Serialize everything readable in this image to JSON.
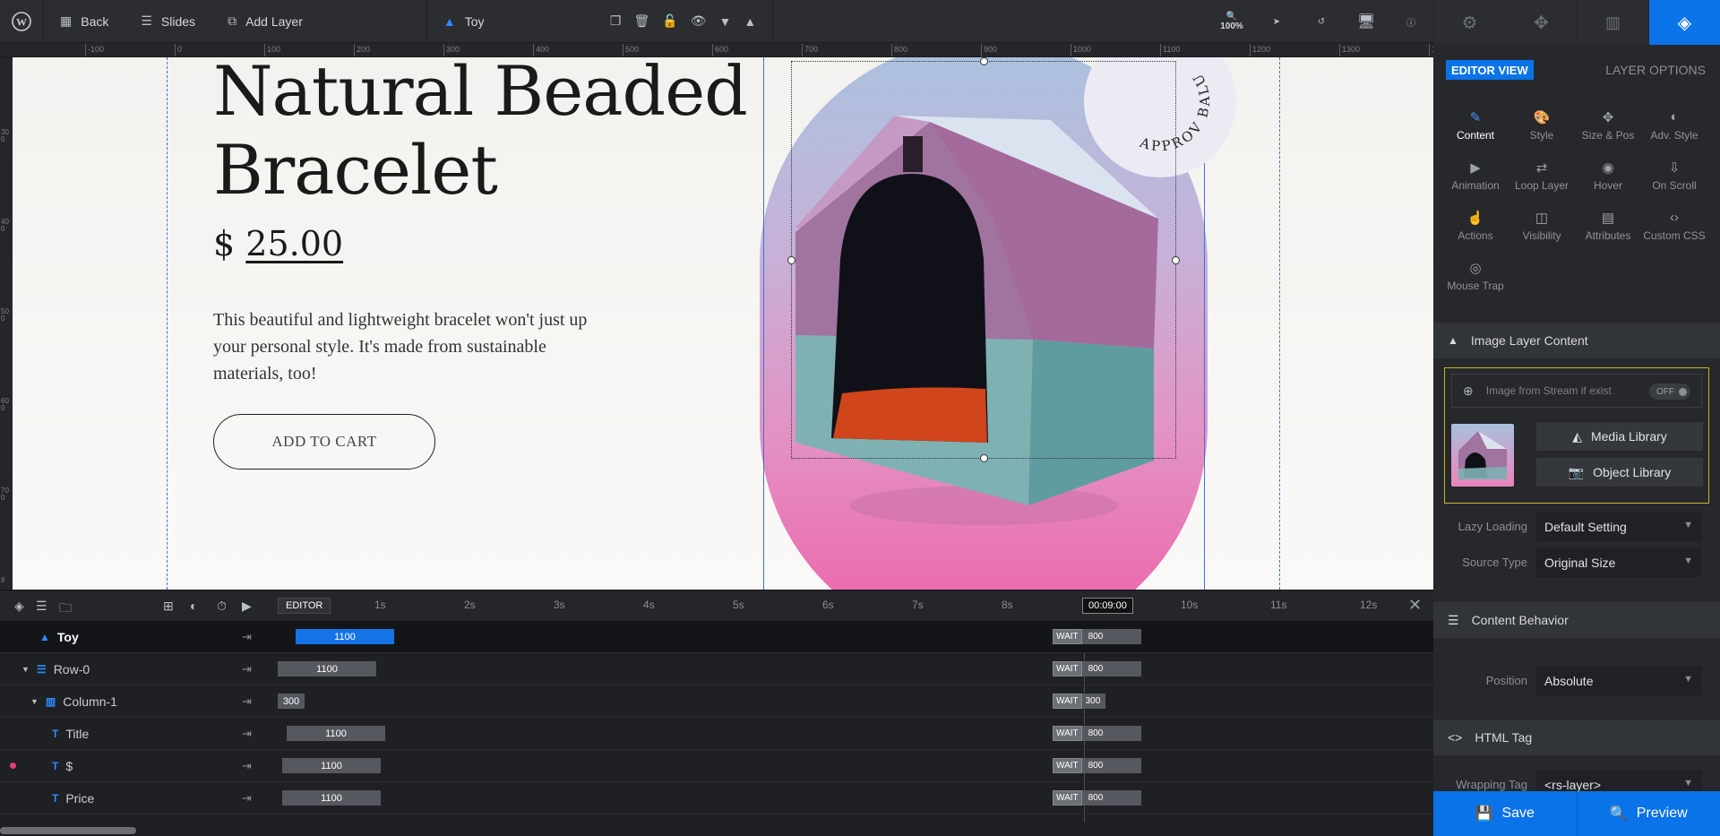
{
  "topbar": {
    "back": "Back",
    "slides": "Slides",
    "add_layer": "Add Layer",
    "layer_name": "Toy",
    "zoom": "100%"
  },
  "ruler": {
    "h_ticks": [
      "-100",
      "0",
      "100",
      "200",
      "300",
      "400",
      "500",
      "600",
      "700",
      "800",
      "900",
      "1000",
      "1100",
      "1200",
      "1300",
      "14"
    ],
    "v_ticks": [
      "300",
      "400",
      "500",
      "600",
      "700",
      "8"
    ]
  },
  "canvas": {
    "title_line1": "Natural Beaded",
    "title_line2": "Bracelet",
    "currency": "$",
    "price": "25.00",
    "description": "This beautiful and lightweight bracelet won't just up your personal style. It's made from sustainable materials, too!",
    "cart_button": "ADD TO CART",
    "badge_text": "APPROV BALU"
  },
  "timeline": {
    "editor_tag": "EDITOR",
    "current_time": "00:09:00",
    "time_ticks": [
      "1s",
      "2s",
      "3s",
      "4s",
      "5s",
      "6s",
      "7s",
      "8s",
      "10s",
      "11s",
      "12s"
    ],
    "wait_label": "WAIT",
    "rows": [
      {
        "name": "Toy",
        "start": "1100",
        "end": "800"
      },
      {
        "name": "Row-0",
        "start": "1100",
        "end": "800"
      },
      {
        "name": "Column-1",
        "start": "300",
        "end": "300"
      },
      {
        "name": "Title",
        "start": "1100",
        "end": "800"
      },
      {
        "name": "$",
        "start": "1100",
        "end": "800"
      },
      {
        "name": "Price",
        "start": "1100",
        "end": "800"
      }
    ]
  },
  "panel": {
    "editor_view": "EDITOR VIEW",
    "layer_options": "LAYER OPTIONS",
    "options": [
      "Content",
      "Style",
      "Size & Pos",
      "Adv. Style",
      "Animation",
      "Loop Layer",
      "Hover",
      "On Scroll",
      "Actions",
      "Visibility",
      "Attributes",
      "Custom CSS",
      "Mouse Trap"
    ],
    "image_section": "Image Layer Content",
    "stream_label": "Image from Stream if exist",
    "stream_toggle": "OFF",
    "media_library": "Media Library",
    "object_library": "Object Library",
    "lazy_label": "Lazy Loading",
    "lazy_value": "Default Setting",
    "source_label": "Source Type",
    "source_value": "Original Size",
    "behavior_section": "Content Behavior",
    "position_label": "Position",
    "position_value": "Absolute",
    "html_section": "HTML Tag",
    "wrapping_label": "Wrapping Tag",
    "wrapping_value": "<rs-layer>"
  },
  "footer": {
    "save": "Save",
    "preview": "Preview"
  },
  "colors": {
    "accent": "#0a73e8",
    "highlight": "#c8b52a"
  }
}
